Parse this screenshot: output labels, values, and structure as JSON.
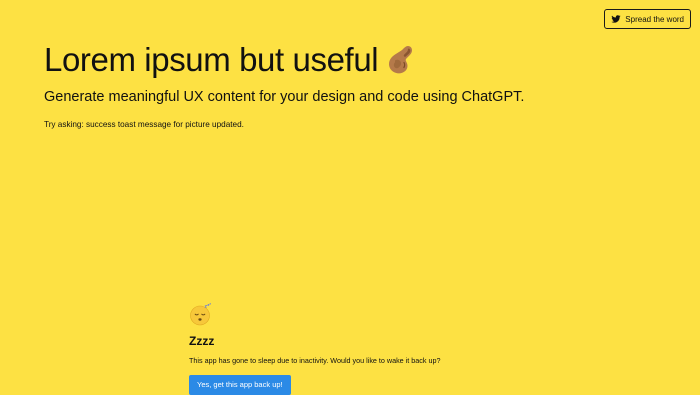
{
  "share": {
    "label": "Spread the word",
    "icon": "twitter-bird-icon"
  },
  "hero": {
    "headline": "Lorem ipsum but useful",
    "headline_icon": "pinching-hand-emoji-icon",
    "subheadline": "Generate meaningful UX content for your design and code using ChatGPT.",
    "hint": "Try asking: success toast message for picture updated."
  },
  "sleep_notice": {
    "icon": "sleeping-face-emoji-icon",
    "title": "Zzzz",
    "message": "This app has gone to sleep due to inactivity. Would you like to wake it back up?",
    "wake_button_label": "Yes, get this app back up!"
  },
  "colors": {
    "background": "#fde143",
    "text": "#111111",
    "button_primary": "#2b8ae6"
  }
}
